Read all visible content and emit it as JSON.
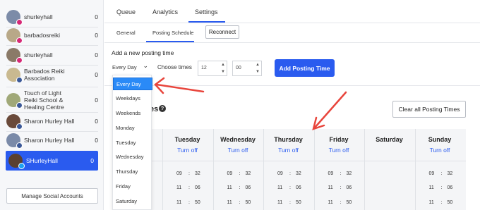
{
  "sidebar": {
    "accounts": [
      {
        "name": "shurleyhall",
        "count": "0",
        "network": "instagram",
        "avatar_color": "#7c8ba8"
      },
      {
        "name": "barbadosreiki",
        "count": "0",
        "network": "instagram",
        "avatar_color": "#b8a888"
      },
      {
        "name": "shurleyhall",
        "count": "0",
        "network": "instagram",
        "avatar_color": "#8a7a68"
      },
      {
        "name": "Barbados Reiki Association",
        "count": "0",
        "network": "facebook",
        "avatar_color": "#c9b990"
      },
      {
        "name": "Touch of Light Reiki School & Healing Centre",
        "count": "0",
        "network": "facebook",
        "avatar_color": "#a0a878"
      },
      {
        "name": "Sharon Hurley Hall",
        "count": "0",
        "network": "facebook",
        "avatar_color": "#6a4a3a"
      },
      {
        "name": "Sharon Hurley Hall",
        "count": "0",
        "network": "facebook",
        "avatar_color": "#7a8aa8"
      },
      {
        "name": "SHurleyHall",
        "count": "0",
        "network": "twitter",
        "avatar_color": "#5a4030"
      }
    ],
    "manage_label": "Manage Social Accounts"
  },
  "tabs": {
    "queue": "Queue",
    "analytics": "Analytics",
    "settings": "Settings"
  },
  "subtabs": {
    "general": "General",
    "posting_schedule": "Posting Schedule",
    "reconnect": "Reconnect"
  },
  "add_time": {
    "section_label": "Add a new posting time",
    "frequency": "Every Day",
    "choose_label": "Choose times",
    "hour": "12",
    "minute": "00",
    "button": "Add Posting Time"
  },
  "dropdown_options": [
    "Every Day",
    "Weekdays",
    "Weekends",
    "Monday",
    "Tuesday",
    "Wednesday",
    "Thursday",
    "Friday",
    "Saturday"
  ],
  "posting_times": {
    "heading_visible": "es",
    "clear_button": "Clear all Posting Times"
  },
  "schedule": {
    "turn_off_label": "Turn off",
    "days": [
      {
        "name": "Tuesday",
        "turn_off": true,
        "times": [
          [
            "09",
            "32"
          ],
          [
            "11",
            "06"
          ],
          [
            "11",
            "50"
          ]
        ]
      },
      {
        "name": "Wednesday",
        "turn_off": true,
        "times": [
          [
            "09",
            "32"
          ],
          [
            "11",
            "06"
          ],
          [
            "11",
            "50"
          ]
        ]
      },
      {
        "name": "Thursday",
        "turn_off": true,
        "times": [
          [
            "09",
            "32"
          ],
          [
            "11",
            "06"
          ],
          [
            "11",
            "50"
          ]
        ]
      },
      {
        "name": "Friday",
        "turn_off": true,
        "times": [
          [
            "09",
            "32"
          ],
          [
            "11",
            "06"
          ],
          [
            "11",
            "50"
          ]
        ]
      },
      {
        "name": "Saturday",
        "turn_off": false,
        "times": []
      },
      {
        "name": "Sunday",
        "turn_off": true,
        "times": [
          [
            "09",
            "32"
          ],
          [
            "11",
            "06"
          ],
          [
            "11",
            "50"
          ]
        ]
      }
    ]
  },
  "colors": {
    "accent": "#2a5bef",
    "dropdown_selected": "#2a8af7",
    "annotation_arrow": "#e8453c"
  }
}
